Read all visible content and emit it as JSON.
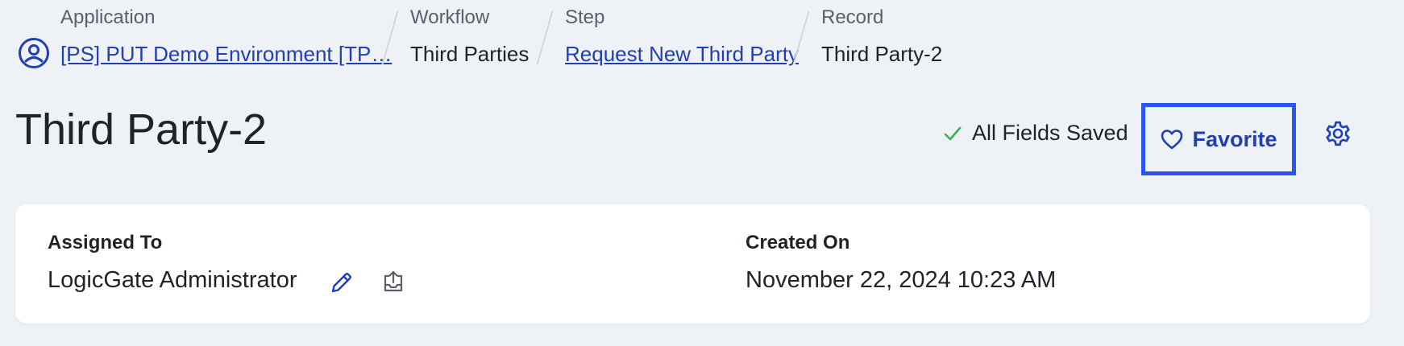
{
  "breadcrumbs": {
    "application": {
      "label": "Application",
      "value": "[PS] PUT Demo Environment [TP…"
    },
    "workflow": {
      "label": "Workflow",
      "value": "Third Parties"
    },
    "step": {
      "label": "Step",
      "value": "Request New Third Party"
    },
    "record": {
      "label": "Record",
      "value": "Third Party-2"
    }
  },
  "header": {
    "title": "Third Party-2",
    "save_status": "All Fields Saved",
    "favorite_label": "Favorite"
  },
  "details": {
    "assigned_to": {
      "label": "Assigned To",
      "value": "LogicGate Administrator"
    },
    "created_on": {
      "label": "Created On",
      "value": "November 22, 2024 10:23 AM"
    }
  },
  "colors": {
    "accent": "#1f3fb5",
    "focus_outline": "#2b55f0",
    "success": "#3bb54a",
    "background": "#eef1f5"
  },
  "icons": [
    "user-circle-icon",
    "check-icon",
    "heart-icon",
    "gear-icon",
    "pencil-icon",
    "upload-icon"
  ]
}
